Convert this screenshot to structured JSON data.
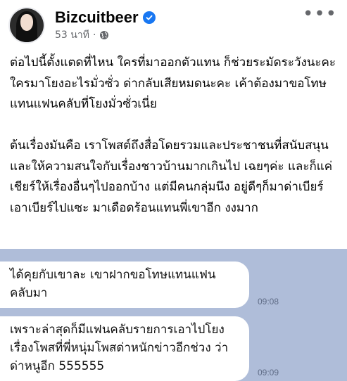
{
  "post": {
    "author": "Bizcuitbeer",
    "timestamp": "53 นาที",
    "separator": "·",
    "avatar_icon": "profile-photo",
    "verified_icon": "verified-badge-icon",
    "privacy_icon": "globe-icon",
    "more_icon": "more-dots-icon",
    "more_label": "•••",
    "paragraphs": [
      "ต่อไปนี้ตั้งแตดที่ไหน ใครที่มาออกตัวแทน ก็ช่วยระมัดระวังนะคะ ใครมาโยงอะไรมั่วซั่ว ด่ากลับเสียหมดนะคะ เค้าต้องมาขอโทษแทนแฟนคลับที่โยงมั่วซั่วเนี่ย",
      "ต้นเรื่องมันคือ เราโพสต์ถึงสื่อโดยรวมและประชาชนที่สนับสนุนและให้ความสนใจกับเรื่องชาวบ้านมากเกินไป เฉยๆค่ะ และก็แค่เชียร์ให้เรื่องอื่นๆไปออกบ้าง แต่มีคนกลุ่มนึง อยู่ดีๆก็มาด่าเบียร์ เอาเบียร์ไปแซะ มาเดือดร้อนแทนพี่เขาอีก งงมาก"
    ]
  },
  "chat": {
    "background_color": "#afbdd9",
    "messages": [
      {
        "text": "ได้คุยกับเขาละ เขาฝากขอโทษแทนแฟนคลับมา",
        "time": "09:08"
      },
      {
        "text": "เพราะล่าสุดก็มีแฟนคลับรายการเอาไปโยง เรื่องโพสที่พี่หนุ่มโพสด่าหนักข่าวอีกช่วง ว่าด่าหนูอีก 555555",
        "time": "09:09"
      }
    ]
  }
}
